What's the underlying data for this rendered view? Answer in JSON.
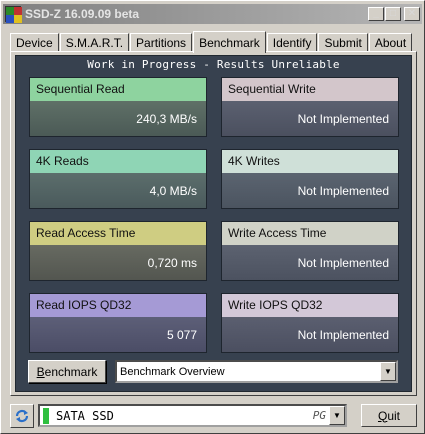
{
  "window": {
    "title": "SSD-Z 16.09.09 beta"
  },
  "title_buttons": {
    "minimize": "_",
    "maximize": "□",
    "close": "✕"
  },
  "tabs": [
    {
      "label": "Device",
      "active": false
    },
    {
      "label": "S.M.A.R.T.",
      "active": false
    },
    {
      "label": "Partitions",
      "active": false
    },
    {
      "label": "Benchmark",
      "active": true
    },
    {
      "label": "Identify",
      "active": false
    },
    {
      "label": "Submit",
      "active": false
    },
    {
      "label": "About",
      "active": false
    }
  ],
  "header": "Work in Progress - Results Unreliable",
  "cards": {
    "seq_read": {
      "label": "Sequential Read",
      "value": "240,3 MB/s"
    },
    "seq_write": {
      "label": "Sequential Write",
      "value": "Not Implemented"
    },
    "k4_read": {
      "label": "4K Reads",
      "value": "4,0 MB/s"
    },
    "k4_write": {
      "label": "4K Writes",
      "value": "Not Implemented"
    },
    "read_access": {
      "label": "Read Access Time",
      "value": "0,720 ms"
    },
    "write_access": {
      "label": "Write Access Time",
      "value": "Not Implemented"
    },
    "read_iops": {
      "label": "Read IOPS QD32",
      "value": "5 077"
    },
    "write_iops": {
      "label": "Write IOPS QD32",
      "value": "Not Implemented"
    }
  },
  "benchmark_button": {
    "underline": "B",
    "rest": "enchmark"
  },
  "benchmark_select": {
    "value": "Benchmark Overview"
  },
  "drive_select": {
    "name": "SATA SSD",
    "tag": "PG"
  },
  "quit_button": {
    "underline": "Q",
    "rest": "uit"
  },
  "icons": {
    "app": "app-logo-icon",
    "refresh": "refresh-icon",
    "dropdown": "chevron-down-icon"
  }
}
